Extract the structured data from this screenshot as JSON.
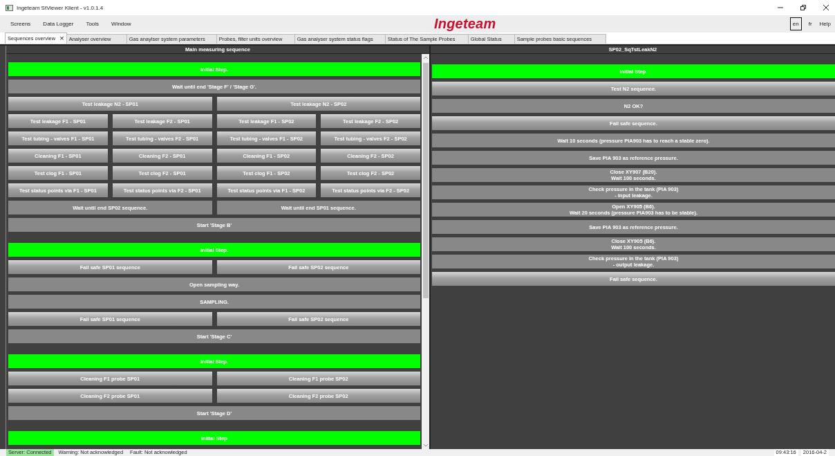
{
  "window": {
    "title": "Ingeteam StViewer Klient - v1.0.1.4"
  },
  "menu": [
    "Screens",
    "Data Logger",
    "Tools",
    "Window"
  ],
  "logo": "Ingeteam",
  "languages": [
    {
      "label": "en",
      "selected": true
    },
    {
      "label": "fr",
      "selected": false
    }
  ],
  "help": "Help",
  "tabs": [
    {
      "label": "Sequences overview",
      "selected": true,
      "close": "×"
    },
    {
      "label": "Analyser overview",
      "selected": false
    },
    {
      "label": "Gas anaylser system parameters",
      "selected": false
    },
    {
      "label": "Probes, filter units overview",
      "selected": false
    },
    {
      "label": "Gas analyser system status flags",
      "selected": false
    },
    {
      "label": "Status of The Sample Probes",
      "selected": false
    },
    {
      "label": "Global Status",
      "selected": false
    },
    {
      "label": "Sample probes basic sequences",
      "selected": false
    }
  ],
  "left_panel": {
    "title": "Main measuring sequence",
    "groups": [
      {
        "rows": [
          [
            {
              "text": "Initial Step.",
              "kind": "active"
            }
          ],
          [
            {
              "text": "Wait until end 'Stage F' / 'Stage G'.",
              "kind": "step"
            }
          ],
          [
            {
              "text": "Test leakage N2 - SP01",
              "kind": "branch"
            },
            {
              "text": "Test leakage N2 - SP02",
              "kind": "branch"
            }
          ],
          [
            {
              "text": "Test leakage F1 - SP01",
              "kind": "branch"
            },
            {
              "text": "Test leakage F2 - SP01",
              "kind": "branch"
            },
            {
              "text": "Test leakage F1 - SP02",
              "kind": "branch"
            },
            {
              "text": "Test leakage F2 - SP02",
              "kind": "branch"
            }
          ],
          [
            {
              "text": "Test tubing - valves F1 - SP01",
              "kind": "branch"
            },
            {
              "text": "Test tubing - valves F2 - SP01",
              "kind": "branch"
            },
            {
              "text": "Test tubing - valves F1 - SP02",
              "kind": "branch"
            },
            {
              "text": "Test tubing - valves F2 - SP02",
              "kind": "branch"
            }
          ],
          [
            {
              "text": "Cleaning F1 - SP01",
              "kind": "branch"
            },
            {
              "text": "Cleaning F2 - SP01",
              "kind": "branch"
            },
            {
              "text": "Cleaning F1 - SP02",
              "kind": "branch"
            },
            {
              "text": "Cleaning F2 - SP02",
              "kind": "branch"
            }
          ],
          [
            {
              "text": "Test clog F1 - SP01",
              "kind": "branch"
            },
            {
              "text": "Test clog F2 - SP01",
              "kind": "branch"
            },
            {
              "text": "Test clog F1 - SP02",
              "kind": "branch"
            },
            {
              "text": "Test clog F2 - SP02",
              "kind": "branch"
            }
          ],
          [
            {
              "text": "Test status points via F1 - SP01",
              "kind": "branch"
            },
            {
              "text": "Test status points via F2 - SP01",
              "kind": "branch"
            },
            {
              "text": "Test status points via F1 - SP02",
              "kind": "branch"
            },
            {
              "text": "Test status points via F2 - SP02",
              "kind": "branch"
            }
          ],
          [
            {
              "text": "Wait until end SP02 sequence.",
              "kind": "step"
            },
            {
              "text": "Wait until end SP01 sequence.",
              "kind": "step"
            }
          ],
          [
            {
              "text": "Start 'Stage B'",
              "kind": "step"
            }
          ]
        ]
      },
      {
        "rows": [
          [
            {
              "text": "Initial Step.",
              "kind": "active"
            }
          ],
          [
            {
              "text": "Fail safe SP01 sequence",
              "kind": "branch"
            },
            {
              "text": "Fail safe SP02 sequence",
              "kind": "branch"
            }
          ],
          [
            {
              "text": "Open sampling way.",
              "kind": "step"
            }
          ],
          [
            {
              "text": "SAMPLING.",
              "kind": "step"
            }
          ],
          [
            {
              "text": "Fail safe SP01 sequence",
              "kind": "branch"
            },
            {
              "text": "Fail safe SP02 sequence",
              "kind": "branch"
            }
          ],
          [
            {
              "text": "Start 'Stage C'",
              "kind": "step"
            }
          ]
        ]
      },
      {
        "rows": [
          [
            {
              "text": "Initial Step.",
              "kind": "active"
            }
          ],
          [
            {
              "text": "Cleaning F1 probe SP01",
              "kind": "branch"
            },
            {
              "text": "Cleaning F1 probe SP02",
              "kind": "branch"
            }
          ],
          [
            {
              "text": "Cleaning F2 probe SP01",
              "kind": "branch"
            },
            {
              "text": "Cleaning F2 probe SP02",
              "kind": "branch"
            }
          ],
          [
            {
              "text": "Start 'Stage D'",
              "kind": "step"
            }
          ]
        ]
      },
      {
        "rows": [
          [
            {
              "text": "Initial Step",
              "kind": "active"
            }
          ]
        ]
      }
    ]
  },
  "right_panel": {
    "title": "SP02_SqTstLeakN2",
    "steps": [
      {
        "text": "Initial Step.",
        "kind": "active"
      },
      {
        "text": "Test N2 sequence.",
        "kind": "branch"
      },
      {
        "text": "N2 OK?",
        "kind": "step"
      },
      {
        "text": "Fail safe sequence.",
        "kind": "branch"
      },
      {
        "text": "Wait 10 seconds (pressure PIA903 has to reach a stable zero).",
        "kind": "step"
      },
      {
        "text": "Save PIA 903 as reference pressure.",
        "kind": "step"
      },
      {
        "text": "Close XY907 (B20).\nWait 100 seconds.",
        "kind": "step"
      },
      {
        "text": "Check pressure in the tank (PIA 903)\n- input leakage.",
        "kind": "step"
      },
      {
        "text": "Open XY905 (B6).\nWait 20 seconds (pressure PIA903 has to be stable).",
        "kind": "step"
      },
      {
        "text": "Save PIA 903 as reference pressure.",
        "kind": "step"
      },
      {
        "text": "Close XY905 (B6).\nWait 100 seconds.",
        "kind": "step"
      },
      {
        "text": "Check pressure in the tank (PIA 903)\n- output leakage.",
        "kind": "step"
      },
      {
        "text": "Fail safe sequence.",
        "kind": "branch"
      }
    ]
  },
  "status_bar": {
    "server": {
      "text": "Server: Connected",
      "connected": true
    },
    "warning": "Warning: Not acknowledged",
    "fault": "Fault: Not acknowledged",
    "time": "09:43:16",
    "date": "2016-04-2"
  }
}
